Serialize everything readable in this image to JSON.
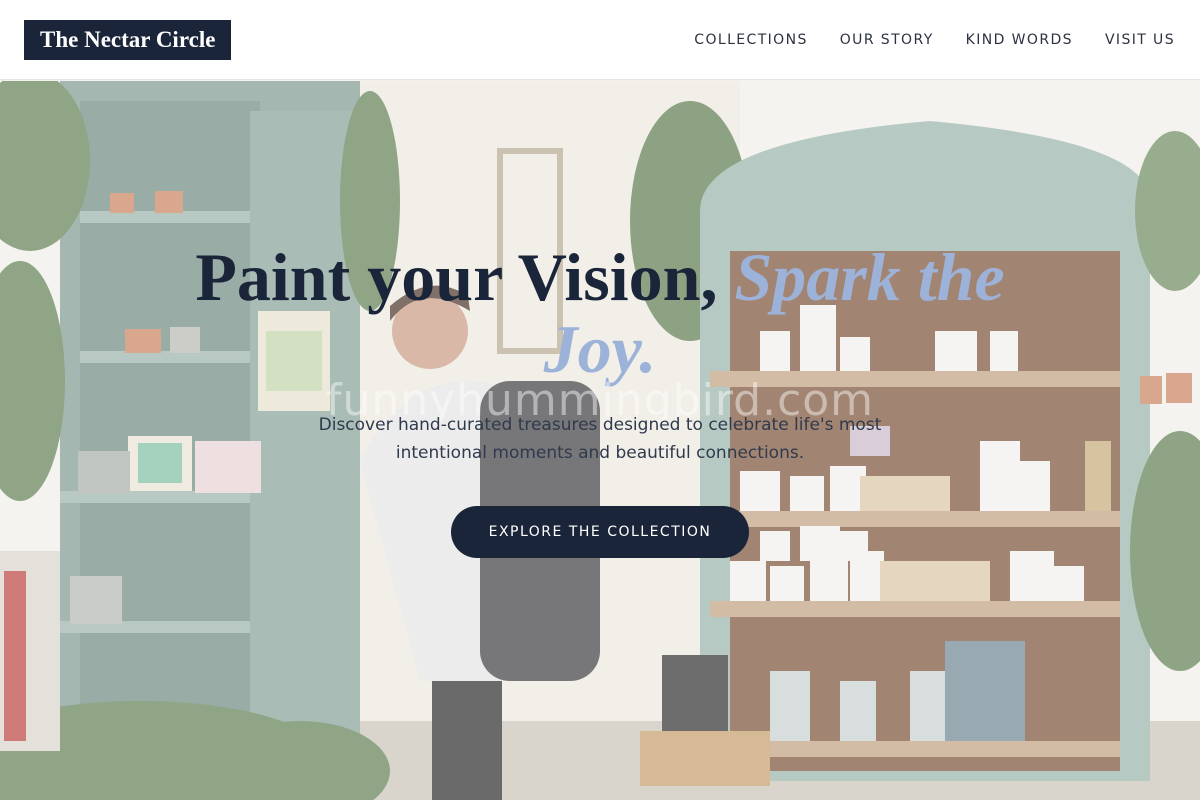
{
  "brand": {
    "name": "The Nectar Circle"
  },
  "nav": {
    "items": [
      {
        "label": "COLLECTIONS"
      },
      {
        "label": "OUR STORY"
      },
      {
        "label": "KIND WORDS"
      },
      {
        "label": "VISIT US"
      }
    ]
  },
  "hero": {
    "headline_main": "Paint your Vision, ",
    "headline_accent": "Spark the Joy.",
    "watermark": "funnyhummingbird.com",
    "subtitle": "Discover hand-curated treasures designed to celebrate life's most intentional moments and beautiful connections.",
    "cta_label": "EXPLORE THE COLLECTION",
    "background_image": "gift shop interior with a man browsing shelves of candles, plants and cards"
  },
  "colors": {
    "navy": "#1b2539",
    "accent": "#9db2d8",
    "cabinet": "#8fa9a2",
    "shelf_wood": "#8a5a3a"
  }
}
